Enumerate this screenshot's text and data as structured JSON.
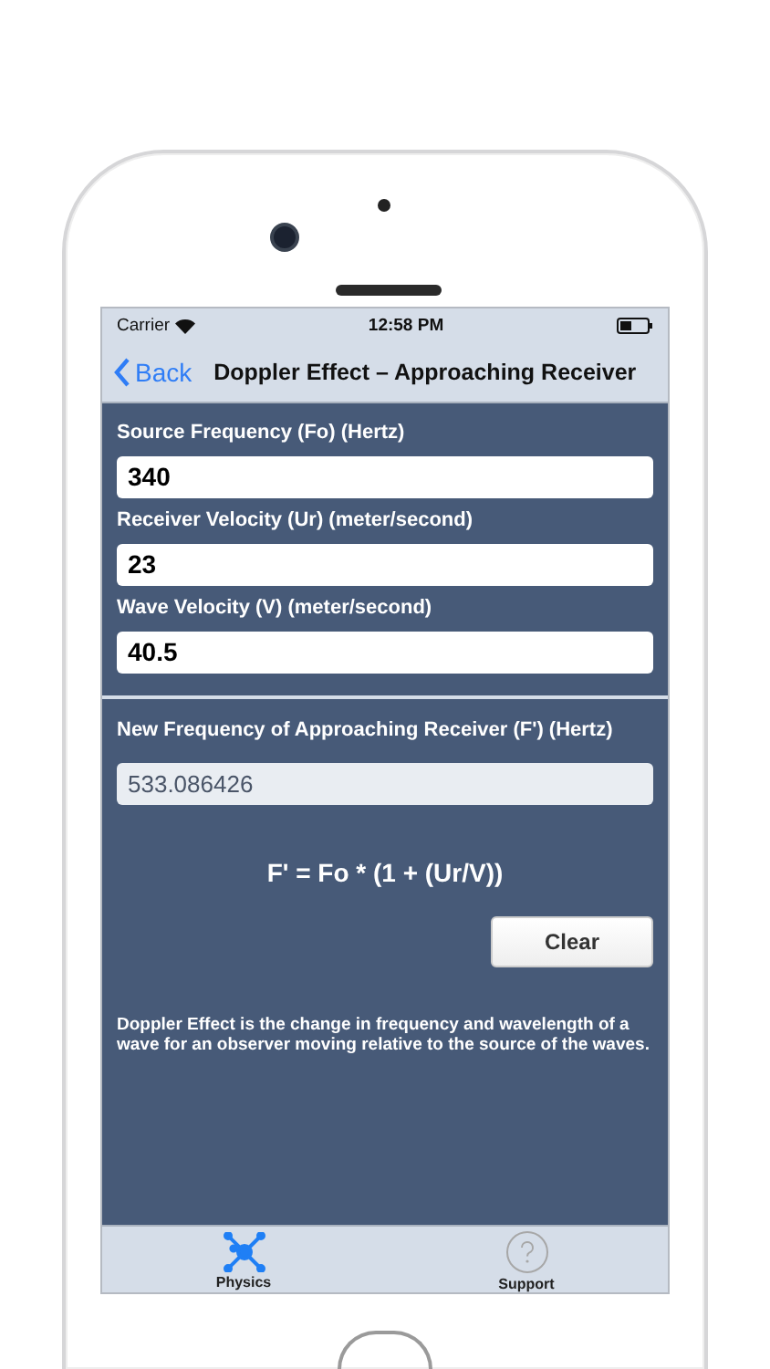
{
  "status_bar": {
    "carrier": "Carrier",
    "time": "12:58 PM"
  },
  "nav_bar": {
    "back": "Back",
    "title": "Doppler Effect – Approaching Receiver"
  },
  "inputs": [
    {
      "label": "Source Frequency (Fo) (Hertz)",
      "value": "340"
    },
    {
      "label": "Receiver Velocity (Ur) (meter/second)",
      "value": "23"
    },
    {
      "label": "Wave Velocity (V) (meter/second)",
      "value": "40.5"
    }
  ],
  "result": {
    "label": "New Frequency of Approaching Receiver (F') (Hertz)",
    "value": "533.086426",
    "disabled": true
  },
  "formula": "F' = Fo * (1 + (Ur/V))",
  "clear_button": "Clear",
  "description": "Doppler Effect is the change in frequency and wavelength of a wave for an observer moving relative to the source of the waves.",
  "tab_bar": [
    {
      "label": "Physics",
      "kind": "network",
      "selected": true
    },
    {
      "label": "Support",
      "kind": "question",
      "selected": false
    }
  ]
}
